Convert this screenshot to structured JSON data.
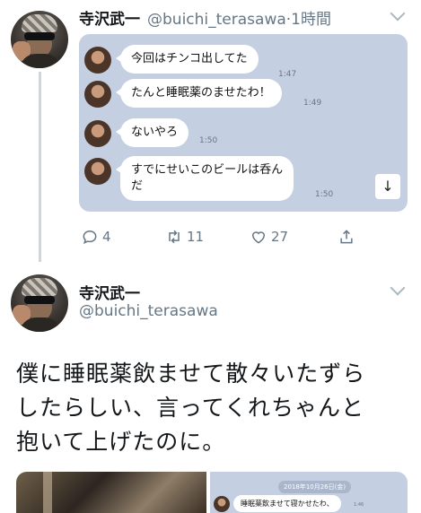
{
  "tweet1": {
    "name": "寺沢武一",
    "handle": "@buichi_terasawa",
    "meta": "·1時間",
    "screenshot": {
      "messages": [
        {
          "text": "今回はチンコ出してた",
          "time": "1:47"
        },
        {
          "text": "たんと睡眠薬のませたわ！",
          "time": "1:49"
        },
        {
          "text": "ないやろ",
          "time": "1:50"
        },
        {
          "text": "すでにせいこのビールは呑ん",
          "text2": "だ",
          "time": "1:50"
        }
      ],
      "scroll_button": "↓"
    },
    "actions": {
      "reply_count": "4",
      "retweet_count": "11",
      "like_count": "27"
    }
  },
  "tweet2": {
    "name": "寺沢武一",
    "handle": "@buichi_terasawa",
    "text_lines": [
      "僕に睡眠薬飲ませて散々いたずら",
      "したらしい、言ってくれちゃんと",
      "抱いて上げたのに。"
    ],
    "image_right": {
      "date": "2018年10月26日(金)",
      "message": "睡眠薬飲ませて寝かせたわ、",
      "time": "1:46"
    }
  }
}
